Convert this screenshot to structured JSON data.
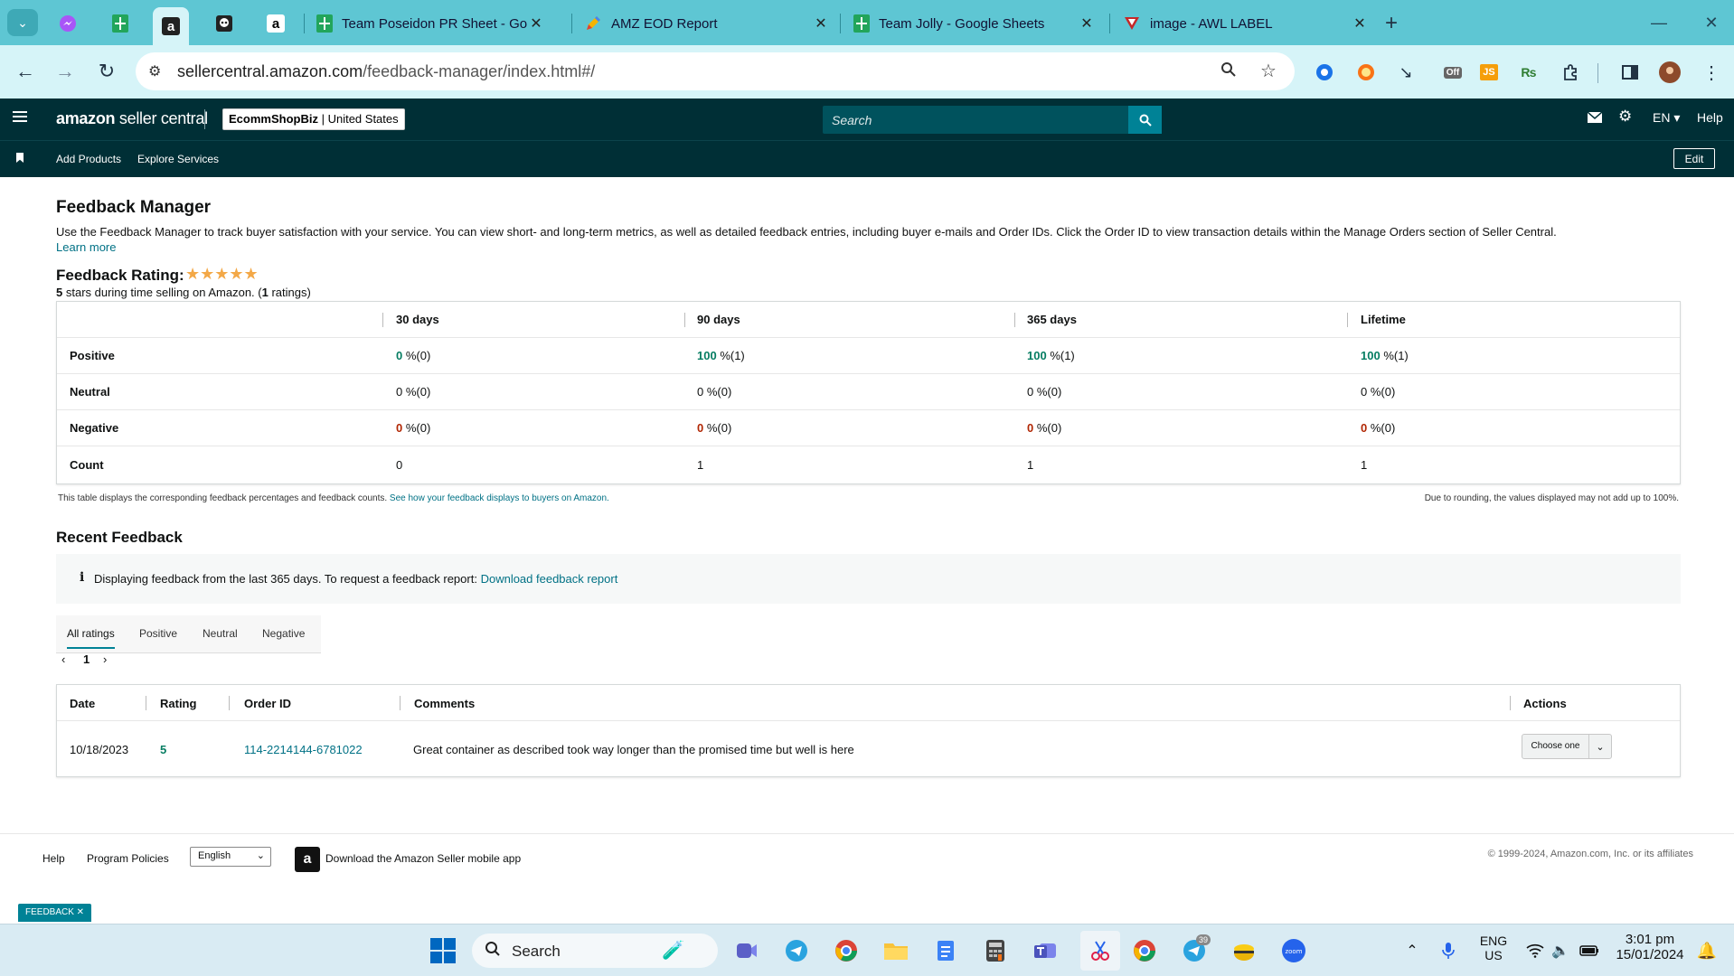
{
  "browser": {
    "tabs": [
      {
        "title": "Team Poseidon PR Sheet - Goo"
      },
      {
        "title": "AMZ EOD Report"
      },
      {
        "title": "Team Jolly - Google Sheets"
      },
      {
        "title": "image - AWL LABEL"
      }
    ],
    "url_host": "sellercentral.amazon.com",
    "url_path": "/feedback-manager/index.html#/",
    "extension_badge": "Off",
    "extension_js": "JS"
  },
  "header": {
    "logo_bold": "amazon",
    "logo_light": "seller central",
    "store_name": "EcommShopBiz",
    "store_region": "United States",
    "search_placeholder": "Search",
    "lang": "EN",
    "help": "Help"
  },
  "subnav": {
    "items": [
      "Add Products",
      "Explore Services"
    ],
    "edit": "Edit"
  },
  "page": {
    "title": "Feedback Manager",
    "intro": "Use the Feedback Manager to track buyer satisfaction with your service. You can view short- and long-term metrics, as well as detailed feedback entries, including buyer e-mails and Order IDs. Click the Order ID to view transaction details within the Manage Orders section of Seller Central.",
    "learn_more": "Learn more",
    "rating_title": "Feedback Rating:",
    "stars": "★★★★★",
    "rating_count_stars": "5",
    "rating_sub_mid": " stars during time selling on Amazon. (",
    "rating_count": "1",
    "rating_sub_end": " ratings)"
  },
  "metrics": {
    "columns": [
      "30 days",
      "90 days",
      "365 days",
      "Lifetime"
    ],
    "rows": {
      "positive": {
        "label": "Positive",
        "values": [
          "0",
          "100",
          "100",
          "100"
        ],
        "suffix": [
          " %(0)",
          " %(1)",
          " %(1)",
          " %(1)"
        ]
      },
      "neutral": {
        "label": "Neutral",
        "values": [
          "0",
          "0",
          "0",
          "0"
        ],
        "suffix": [
          " %(0)",
          " %(0)",
          " %(0)",
          " %(0)"
        ]
      },
      "negative": {
        "label": "Negative",
        "values": [
          "0",
          "0",
          "0",
          "0"
        ],
        "suffix": [
          " %(0)",
          " %(0)",
          " %(0)",
          " %(0)"
        ]
      },
      "count": {
        "label": "Count",
        "values": [
          "0",
          "1",
          "1",
          "1"
        ]
      }
    },
    "note": "This table displays the corresponding feedback percentages and feedback counts.",
    "note_link": "See how your feedback displays to buyers on Amazon.",
    "rounding_note": "Due to rounding, the values displayed may not add up to 100%."
  },
  "recent": {
    "title": "Recent Feedback",
    "info_text": "Displaying feedback from the last 365 days. To request a feedback report:",
    "info_link": "Download feedback report",
    "tabs": [
      "All ratings",
      "Positive",
      "Neutral",
      "Negative"
    ],
    "page": "1",
    "columns": [
      "Date",
      "Rating",
      "Order ID",
      "Comments",
      "Actions"
    ],
    "rows": [
      {
        "date": "10/18/2023",
        "rating": "5",
        "order_id": "114-2214144-6781022",
        "comment": "Great container as described took way longer than the promised time but well is here",
        "action": "Choose one"
      }
    ]
  },
  "footer": {
    "help": "Help",
    "policies": "Program Policies",
    "language": "English",
    "app_text": "Download the Amazon Seller mobile app",
    "copyright": "© 1999-2024, Amazon.com, Inc. or its affiliates",
    "feedback_pill": "FEEDBACK ✕"
  },
  "taskbar": {
    "search": "Search",
    "telegram_badge": "39",
    "lang_top": "ENG",
    "lang_bottom": "US",
    "time": "3:01 pm",
    "date": "15/01/2024"
  },
  "colors": {
    "tabstrip": "#5ec6d3",
    "header_bg": "#002f36",
    "accent": "#008296",
    "link": "#007185",
    "positive_green": "#067d62",
    "negative_red": "#b12704",
    "star": "#f3a847"
  }
}
